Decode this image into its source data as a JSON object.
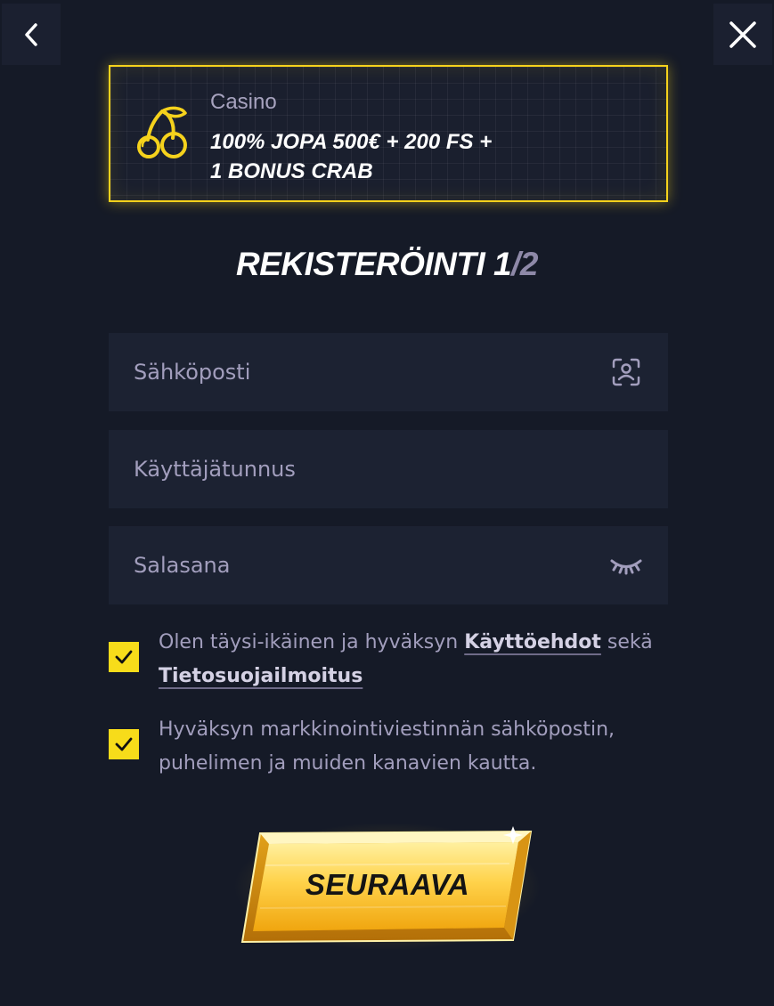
{
  "nav": {
    "back_icon": "chevron-left-icon",
    "close_icon": "close-icon"
  },
  "promo": {
    "icon": "cherry-icon",
    "category": "Casino",
    "offer_line1": "100% JOPA 500€ + 200 FS +",
    "offer_line2": "1 BONUS CRAB",
    "accent_color": "#f5d21c"
  },
  "title": {
    "main": "REKISTERÖINTI 1",
    "separator": "/",
    "total": "2"
  },
  "form": {
    "email": {
      "placeholder": "Sähköposti",
      "value": "",
      "icon": "face-scan-icon"
    },
    "username": {
      "placeholder": "Käyttäjätunnus",
      "value": ""
    },
    "password": {
      "placeholder": "Salasana",
      "value": "",
      "icon": "eye-closed-icon"
    }
  },
  "consents": [
    {
      "checked": true,
      "text_before": "Olen täysi-ikäinen ja hyväksyn ",
      "link1": "Käyttöehdot",
      "text_between": " sekä ",
      "link2": "Tietosuojailmoitus"
    },
    {
      "checked": true,
      "text": "Hyväksyn markkinointiviestinnän sähköpostin, puhelimen ja muiden kanavien kautta."
    }
  ],
  "cta": {
    "label": "SEURAAVA",
    "color": "#f7c21a"
  }
}
